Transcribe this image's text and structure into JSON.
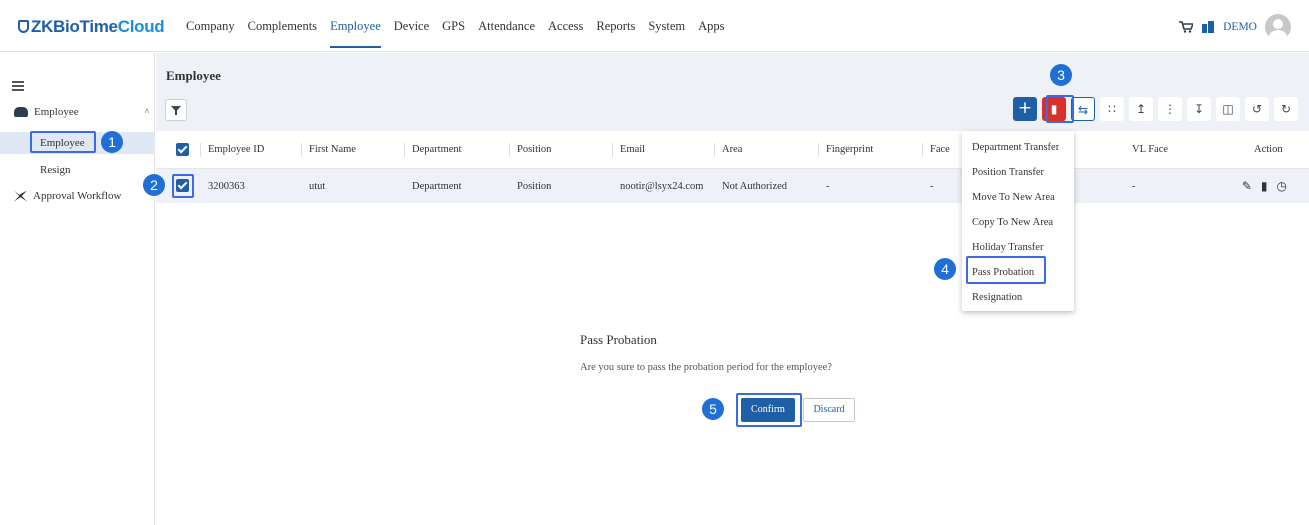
{
  "app": {
    "logo_main": "ZKBioTime",
    "logo_accent": "Cloud",
    "user": "DEMO"
  },
  "nav": [
    "Company",
    "Complements",
    "Employee",
    "Device",
    "GPS",
    "Attendance",
    "Access",
    "Reports",
    "System",
    "Apps"
  ],
  "sidebar": {
    "group": "Employee",
    "items": [
      "Employee",
      "Resign"
    ],
    "group2": "Approval Workflow"
  },
  "page": {
    "title": "Employee"
  },
  "table": {
    "headers": [
      "Employee ID",
      "First Name",
      "Department",
      "Position",
      "Email",
      "Area",
      "Fingerprint",
      "Face",
      "VL Face",
      "Action"
    ],
    "row": {
      "id": "3200363",
      "first_name": "utut",
      "department": "Department",
      "position": "Position",
      "email": "nootir@lsyx24.com",
      "area": "Not Authorized",
      "fingerprint": "-",
      "face": "-",
      "vl_face": "-"
    }
  },
  "dropdown": [
    "Department Transfer",
    "Position Transfer",
    "Move To New Area",
    "Copy To New Area",
    "Holiday Transfer",
    "Pass Probation",
    "Resignation"
  ],
  "modal": {
    "title": "Pass Probation",
    "message": "Are you sure to pass the probation period for the employee?",
    "confirm": "Confirm",
    "discard": "Discard"
  },
  "markers": [
    "1",
    "2",
    "3",
    "4",
    "5"
  ],
  "colors": {
    "primary": "#1f5fa5",
    "danger": "#d9302c",
    "marker": "#1f6fd6"
  }
}
